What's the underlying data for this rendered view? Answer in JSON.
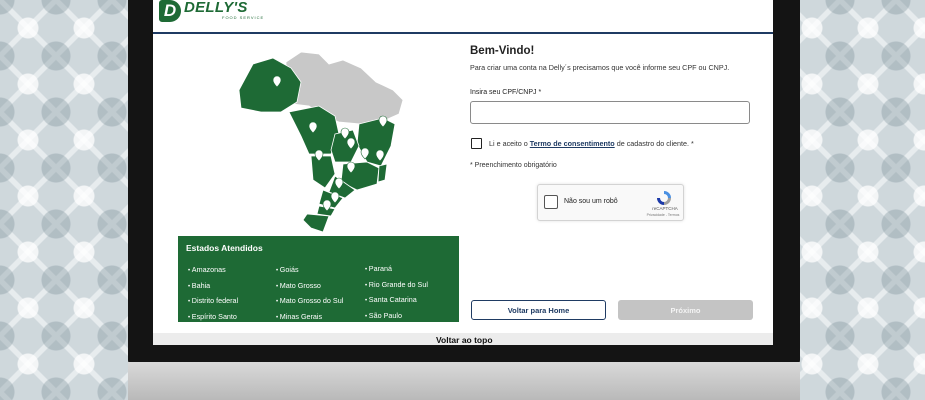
{
  "brand": {
    "name": "DELLY'S",
    "subtitle": "FOOD SERVICE",
    "initial": "D"
  },
  "colors": {
    "brand_green": "#1e6a35",
    "navy": "#1f3b63",
    "map_gray": "#c8c8c8",
    "disabled": "#c4c4c4"
  },
  "form": {
    "title": "Bem-Vindo!",
    "intro": "Para criar uma conta na Delly´s precisamos que você informe seu CPF ou CNPJ.",
    "cpf_label": "Insira seu CPF/CNPJ *",
    "cpf_value": "",
    "consent_before": "Li e aceito o ",
    "consent_link": "Termo de consentimento",
    "consent_after": " de cadastro do cliente. *",
    "consent_checked": false,
    "required_note": "* Preenchimento obrigatório"
  },
  "captcha": {
    "label": "Não sou um robô",
    "brand": "reCAPTCHA",
    "links": "Privacidade - Termos",
    "checked": false
  },
  "buttons": {
    "home": "Voltar para Home",
    "next": "Próximo"
  },
  "states": {
    "title": "Estados Atendidos",
    "col1": [
      "Amazonas",
      "Bahia",
      "Distrito federal",
      "Espírito Santo"
    ],
    "col2": [
      "Goiás",
      "Mato Grosso",
      "Mato Grosso do Sul",
      "Minas Gerais"
    ],
    "col3": [
      "Paraná",
      "Rio Grande do Sul",
      "Santa Catarina",
      "São Paulo"
    ]
  },
  "footer": {
    "back_to_top": "Voltar ao topo"
  }
}
